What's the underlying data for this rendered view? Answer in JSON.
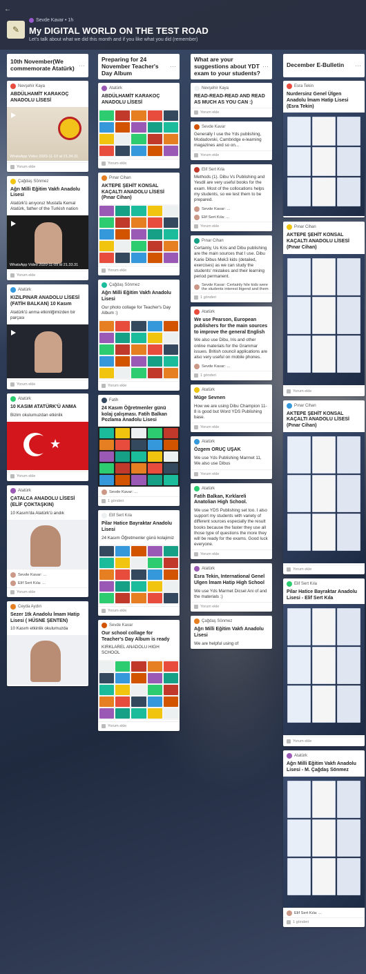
{
  "header": {
    "back": "←",
    "meta": "Sevde Kavar  •  1h",
    "title": "My DIGITAL WORLD ON THE TEST ROAD",
    "subtitle": "Let's talk about what we did this month and if you like what you did (remember)"
  },
  "columns": [
    {
      "title": "10th November(We commemorate Atatürk)",
      "cards": [
        {
          "author": "Nevşehir Kaya",
          "title": "ABDÜLHAMİT KARAKOÇ ANADOLU LİSESİ",
          "text": "",
          "media": "video",
          "caption": "WhatsApp Video 2020-11-10 at 21.34.31",
          "footer": "Yorum ekle"
        },
        {
          "author": "Çağdaş Sönmez",
          "title": "Ağrı Milli Eğitim Vakfı Anadolu Lisesi",
          "text": "Atatürk'ü anıyoruz Mustafa Kemal Atatürk, father of the Turkish nation",
          "media": "video",
          "caption": "WhatsApp Video 2020-11-09 at 21.33.31",
          "footer": "Yorum ekle"
        },
        {
          "author": "Atatürk",
          "title": "KIZILPINAR ANADOLU LİSESİ (FATİH BALKAN) 10 Kasım",
          "text": "Atatürk'ü anma etkinliğimizden bir parçası",
          "media": "video",
          "caption": "",
          "footer": "Yorum ekle"
        },
        {
          "author": "Atatürk",
          "title": "10 KASIM ATATÜRK'Ü ANMA",
          "text": "Bizim okulumuzdan etkinlik",
          "media": "flag",
          "caption": "",
          "footer": "Yorum ekle"
        },
        {
          "author": "Atatürk",
          "title": "ÇATALCA ANADOLU LİSESİ (ELİF ÇOKTAŞKIN)",
          "text": "10 Kasım'da Atatürk'ü andık",
          "media": "photo",
          "caption": "",
          "footer": "Yorum ekle",
          "comments": [
            "Sevde Kavar: ...",
            " Elif Sert Kıla: ..."
          ]
        },
        {
          "author": "Ceyda Aydın",
          "title": "Sezer 1tk Anadolu İmam Hatip Lisesi ( HÜSNE ŞENTEN)",
          "text": "10 Kasım etkinlik okulumuzda",
          "media": "photo2",
          "caption": "",
          "footer": ""
        }
      ]
    },
    {
      "title": "Preparing for 24 November Teacher's Day Album",
      "cards": [
        {
          "author": "Atatürk",
          "title": "ABDÜLHAMİT KARAKOÇ ANADOLU LİSESİ",
          "text": "",
          "media": "collage1",
          "footer": "Yorum ekle"
        },
        {
          "author": "Pınar Cihan",
          "title": "AKTEPE ŞEHİT KONSAL KAÇALTI ANADOLU LİSESİ (Pınar Cihan)",
          "text": "",
          "media": "collage2",
          "footer": "Yorum ekle"
        },
        {
          "author": "Çağdaş Sönmez",
          "title": "Ağrı Milli Eğitim Vakfı Anadolu Lisesi",
          "text": "Our photo collage for Teacher's Day Album :)",
          "media": "collage3",
          "footer": "Yorum ekle"
        },
        {
          "author": "Fatih",
          "title": "24 Kasım Öğretmenler günü kolaj çalışması. Fatih Balkan Pozlama Anadolu Lisesi",
          "text": "",
          "media": "collage4",
          "footer": "1 gönderi",
          "comments": [
            "Sevde Kavar: ..."
          ]
        },
        {
          "author": "Elif Sert Kıla",
          "title": "Pilar Hatice Bayraktar Anadolu Lisesi",
          "text": "24 Kasım Öğretmenler günü kolajimiz",
          "media": "collage5",
          "footer": "Yorum ekle"
        },
        {
          "author": "Sevde Kavar",
          "title": "Our school collage for Teacher's Day Album is ready",
          "text": "KIRKLAREL ANADOLU HIGH SCHOOL",
          "media": "collage6",
          "footer": "Yorum ekle"
        }
      ]
    },
    {
      "title": "What are your suggestions about YDT exam to your students?",
      "cards": [
        {
          "author": "Nevşehir Kaya",
          "title": "READ-READ-READ AND READ AS MUCH AS YOU CAN :)",
          "text": "",
          "footer": "Yorum ekle"
        },
        {
          "author": "Sevde Kavar",
          "title": "",
          "text": "Generally I use the Yds publishing, Modadovski, Cambridge e-learning magazines and so on...",
          "footer": "Yorum ekle"
        },
        {
          "author": "Elif Sert Kıla",
          "title": "",
          "text": "Methods (1). Dibu Vs Publishing and Yesdil are very useful books for the exam. Most of the collocations helps my students, so we test them to be prepared.",
          "footer": "Yorum ekle",
          "comments": [
            "Sevde Kavar: ...",
            "Elif Sert Kıla: ..."
          ]
        },
        {
          "author": "Pınar Cihan",
          "title": "",
          "text": "Certainly, Us Kris and Dibu publishing are the main sources that I use. Dibu Karie Dibus Mek3 kids (detailed, exercises) as we can study the students' mistakes and their learning period permanent.",
          "footer": "1 gönderi",
          "comments": [
            "Sevde Kavar: Certainly hile kids were the students interest litgend and them"
          ]
        },
        {
          "author": "Atatürk",
          "title": "We use Pearson, European publishers for the main sources to improve the general English",
          "text": "We also use Dibu, Iris and other online materials for the Grammar issues. British council applications are also very useful on mobile phones.",
          "footer": "1 gönderi",
          "comments": [
            "Sevde Kavar: ..."
          ]
        },
        {
          "author": "Atatürk",
          "title": "Müge Sevnen",
          "text": "How we are using Dibu Champion 11-8 is good but Word YDS Publishing base.",
          "footer": "Yorum ekle"
        },
        {
          "author": "Atatürk",
          "title": "Özgem ORUÇ UŞAK",
          "text": "We use Yds Publishing Marmet 11, We also use Dibus",
          "footer": "Yorum ekle"
        },
        {
          "author": "Atatürk",
          "title": "Fatih Balkan, Kırklareli Anatolian High School.",
          "text": "We use YDS Publishing set too. I also support my students with variety of different sources especially the result books because the faster they use all those type of questions the more they will be ready for the exams. Good luck everyone.",
          "footer": "Yorum ekle"
        },
        {
          "author": "Atatürk",
          "title": "Esra Tekin, International Genel Ulgen İmam Hatip High School",
          "text": "We use Yds Marmet Dicsel Ani of and the materials :)",
          "footer": "Yorum ekle"
        },
        {
          "author": "Çağdaş Sönmez",
          "title": "Ağrı Milli Eğitim Vakfı Anadolu Lisesi",
          "text": "We are helpful using of",
          "footer": ""
        }
      ]
    },
    {
      "title": "December E-Bulletin",
      "cards": [
        {
          "author": "Esra Tekin",
          "title": "Nurdersinz Genel Ülgen Anadolu İmam Hatip Lisesi (Esra Tekin)",
          "text": "",
          "media": "bulletin1",
          "footer": ""
        },
        {
          "author": "Pınar Cihan",
          "title": "AKTEPE ŞEHİT KONSAL KAÇALTI ANADOLU LİSESİ (Pınar Cihan)",
          "text": "",
          "media": "bulletin2",
          "footer": "Yorum ekle"
        },
        {
          "author": "Pınar Cihan",
          "title": "AKTEPE ŞEHİT KONSAL KAÇALTI ANADOLU LİSESİ (Pınar Cihan)",
          "text": "",
          "media": "bulletin3",
          "footer": "Yorum ekle"
        },
        {
          "author": "Elif Sert Kıla",
          "title": "Pilar Hatice Bayraktar Anadolu Lisesi - Elif Sert Kıla",
          "text": "",
          "media": "bulletin4",
          "footer": "Yorum ekle"
        },
        {
          "author": "Atatürk",
          "title": "Ağrı Milli Eğitim Vakfı Anadolu Lisesi - M. Çağdaş Sönmez",
          "text": "",
          "media": "bulletin5",
          "footer": "1 gönderi",
          "comments": [
            "Elif Sert Kıla: ..."
          ]
        }
      ]
    }
  ],
  "colors": {
    "header_bg": "#282c3a",
    "card_bg": "#ffffff",
    "accent": "#9b59d0"
  }
}
